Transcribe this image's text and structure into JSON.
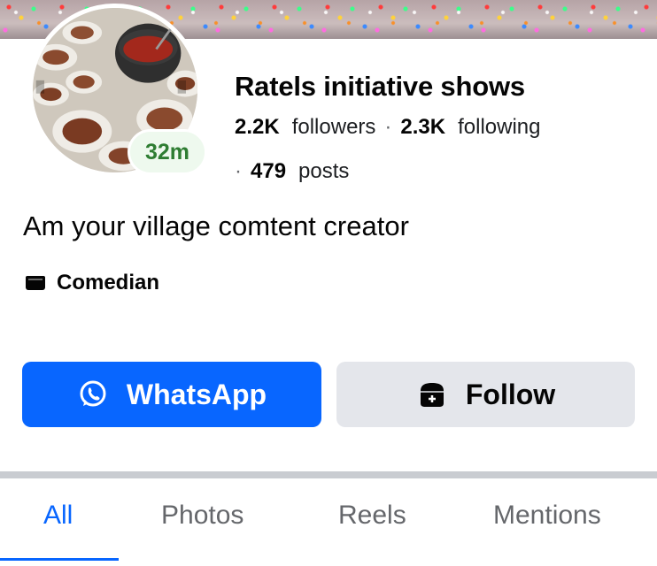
{
  "profile": {
    "name": "Ratels initiative shows",
    "status_time": "32m",
    "followers_count": "2.2K",
    "followers_label": "followers",
    "following_count": "2.3K",
    "following_label": "following",
    "separator": "·",
    "posts_count": "479",
    "posts_label": "posts",
    "bio": "Am your village comtent creator",
    "category_icon": "category-card-icon",
    "category": "Comedian"
  },
  "actions": {
    "whatsapp_icon": "whatsapp-icon",
    "whatsapp_label": "WhatsApp",
    "follow_icon": "add-follow-icon",
    "follow_label": "Follow"
  },
  "tabs": [
    {
      "label": "All",
      "active": true
    },
    {
      "label": "Photos",
      "active": false
    },
    {
      "label": "Reels",
      "active": false
    },
    {
      "label": "Mentions",
      "active": false
    }
  ],
  "colors": {
    "accent": "#0866ff",
    "button_secondary": "#e4e6eb",
    "status_green": "#2e7d32",
    "muted_text": "#65676b"
  }
}
